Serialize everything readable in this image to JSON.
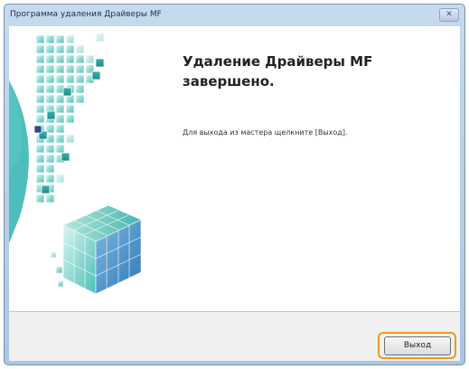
{
  "window": {
    "title": "Программа удаления Драйверы MF",
    "close_glyph": "✕"
  },
  "main": {
    "heading": "Удаление Драйверы MF завершено.",
    "description": "Для выхода из мастера щелкните [Выход]."
  },
  "buttons": {
    "exit_label": "Выход"
  },
  "colors": {
    "accent_teal": "#2fb3b0",
    "highlight_orange": "#ee9a1f"
  },
  "icons": {
    "graphic": "canon-cube-graphic"
  }
}
